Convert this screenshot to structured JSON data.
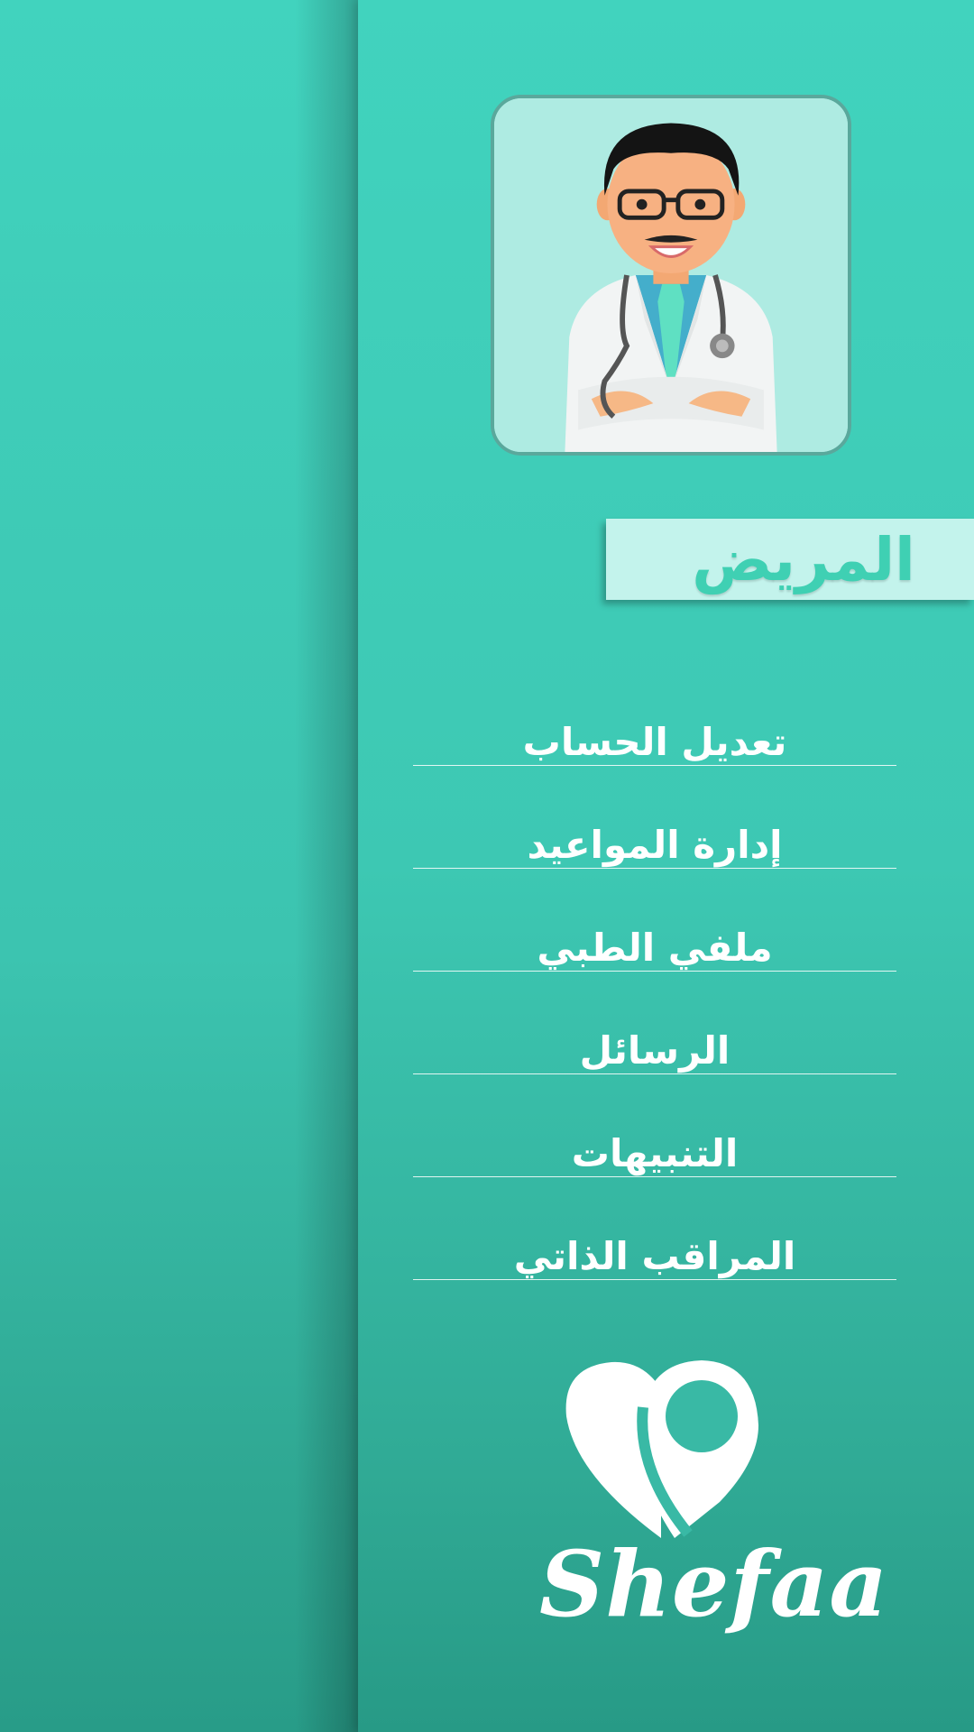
{
  "drawer": {
    "role_title": "المريض",
    "menu": [
      {
        "label": "تعديل الحساب"
      },
      {
        "label": "إدارة المواعيد"
      },
      {
        "label": "ملفي الطبي"
      },
      {
        "label": "الرسائل"
      },
      {
        "label": "التنبيهات"
      },
      {
        "label": "المراقب الذاتي"
      }
    ],
    "brand_name": "Shefaa"
  },
  "colors": {
    "background": "#41d3be",
    "banner": "#c3f3ec",
    "banner_text": "#3fd0b3",
    "menu_text": "#ffffff"
  },
  "icons": {
    "avatar": "doctor-avatar-icon",
    "logo": "heart-location-pin-icon"
  }
}
